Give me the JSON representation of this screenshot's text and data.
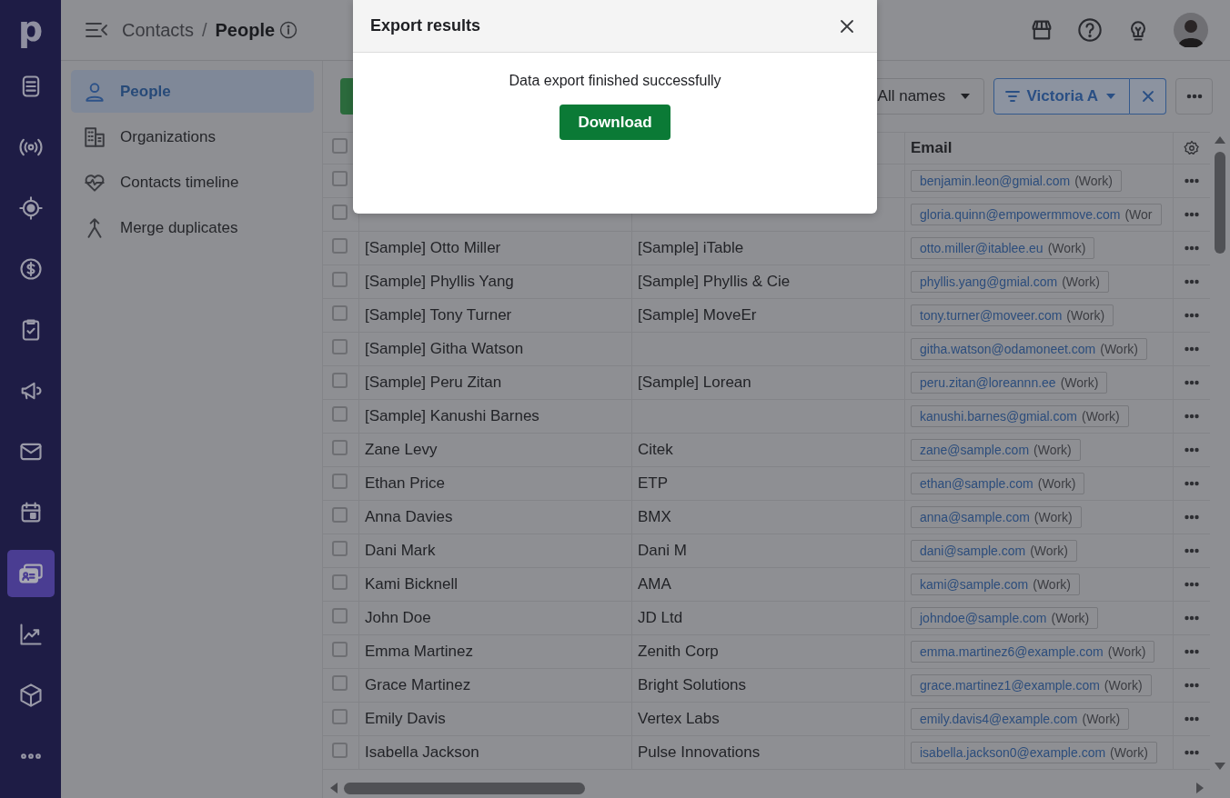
{
  "nav_rail": {
    "logo": "p",
    "items": [
      {
        "selected": false
      },
      {
        "selected": false
      },
      {
        "selected": false
      },
      {
        "selected": false
      },
      {
        "selected": false
      },
      {
        "selected": false
      },
      {
        "selected": false
      },
      {
        "selected": false
      },
      {
        "selected": true
      },
      {
        "selected": false
      },
      {
        "selected": false
      },
      {
        "selected": false
      }
    ]
  },
  "header": {
    "breadcrumb_parent": "Contacts",
    "separator": "/",
    "breadcrumb_current": "People"
  },
  "sidebar": {
    "items": [
      {
        "label": "People",
        "selected": true
      },
      {
        "label": "Organizations",
        "selected": false
      },
      {
        "label": "Contacts timeline",
        "selected": false
      },
      {
        "label": "Merge duplicates",
        "selected": false
      }
    ]
  },
  "toolbar": {
    "owner_filter": "All names",
    "saved_filter": "Victoria A"
  },
  "table": {
    "select_all_checked": false,
    "email_column": "Email",
    "rows": [
      {
        "checked": false,
        "email": "benjamin.leon@gmial.com",
        "email_label": "(Work)"
      },
      {
        "checked": false,
        "email": "gloria.quinn@empowermmove.com",
        "email_label": "(Wor"
      },
      {
        "checked": false,
        "name": "[Sample] Otto Miller",
        "organization": "[Sample] iTable",
        "email": "otto.miller@itablee.eu",
        "email_label": "(Work)"
      },
      {
        "checked": false,
        "name": "[Sample] Phyllis Yang",
        "organization": "[Sample] Phyllis & Cie",
        "email": "phyllis.yang@gmial.com",
        "email_label": "(Work)"
      },
      {
        "checked": false,
        "name": "[Sample] Tony Turner",
        "organization": "[Sample] MoveEr",
        "email": "tony.turner@moveer.com",
        "email_label": "(Work)"
      },
      {
        "checked": false,
        "name": "[Sample] Githa Watson",
        "email": "githa.watson@odamoneet.com",
        "email_label": "(Work)"
      },
      {
        "checked": false,
        "name": "[Sample] Peru Zitan",
        "organization": "[Sample] Lorean",
        "email": "peru.zitan@loreannn.ee",
        "email_label": "(Work)"
      },
      {
        "checked": false,
        "name": "[Sample] Kanushi Barnes",
        "email": "kanushi.barnes@gmial.com",
        "email_label": "(Work)"
      },
      {
        "checked": false,
        "name": "Zane Levy",
        "organization": "Citek",
        "email": "zane@sample.com",
        "email_label": "(Work)"
      },
      {
        "checked": false,
        "name": "Ethan Price",
        "organization": "ETP",
        "email": "ethan@sample.com",
        "email_label": "(Work)"
      },
      {
        "checked": false,
        "name": "Anna Davies",
        "organization": "BMX",
        "email": "anna@sample.com",
        "email_label": "(Work)"
      },
      {
        "checked": false,
        "name": "Dani Mark",
        "organization": "Dani M",
        "email": "dani@sample.com",
        "email_label": "(Work)"
      },
      {
        "checked": false,
        "name": "Kami Bicknell",
        "organization": "AMA",
        "email": "kami@sample.com",
        "email_label": "(Work)"
      },
      {
        "checked": false,
        "name": "John Doe",
        "organization": "JD Ltd",
        "email": "johndoe@sample.com",
        "email_label": "(Work)"
      },
      {
        "checked": false,
        "name": "Emma Martinez",
        "organization": "Zenith Corp",
        "email": "emma.martinez6@example.com",
        "email_label": "(Work)"
      },
      {
        "checked": false,
        "name": "Grace Martinez",
        "organization": "Bright Solutions",
        "email": "grace.martinez1@example.com",
        "email_label": "(Work)"
      },
      {
        "checked": false,
        "name": "Emily Davis",
        "organization": "Vertex Labs",
        "email": "emily.davis4@example.com",
        "email_label": "(Work)"
      },
      {
        "checked": false,
        "name": "Isabella Jackson",
        "organization": "Pulse Innovations",
        "email": "isabella.jackson0@example.com",
        "email_label": "(Work)"
      }
    ]
  },
  "modal": {
    "title": "Export results",
    "message": "Data export finished successfully",
    "button": "Download"
  }
}
